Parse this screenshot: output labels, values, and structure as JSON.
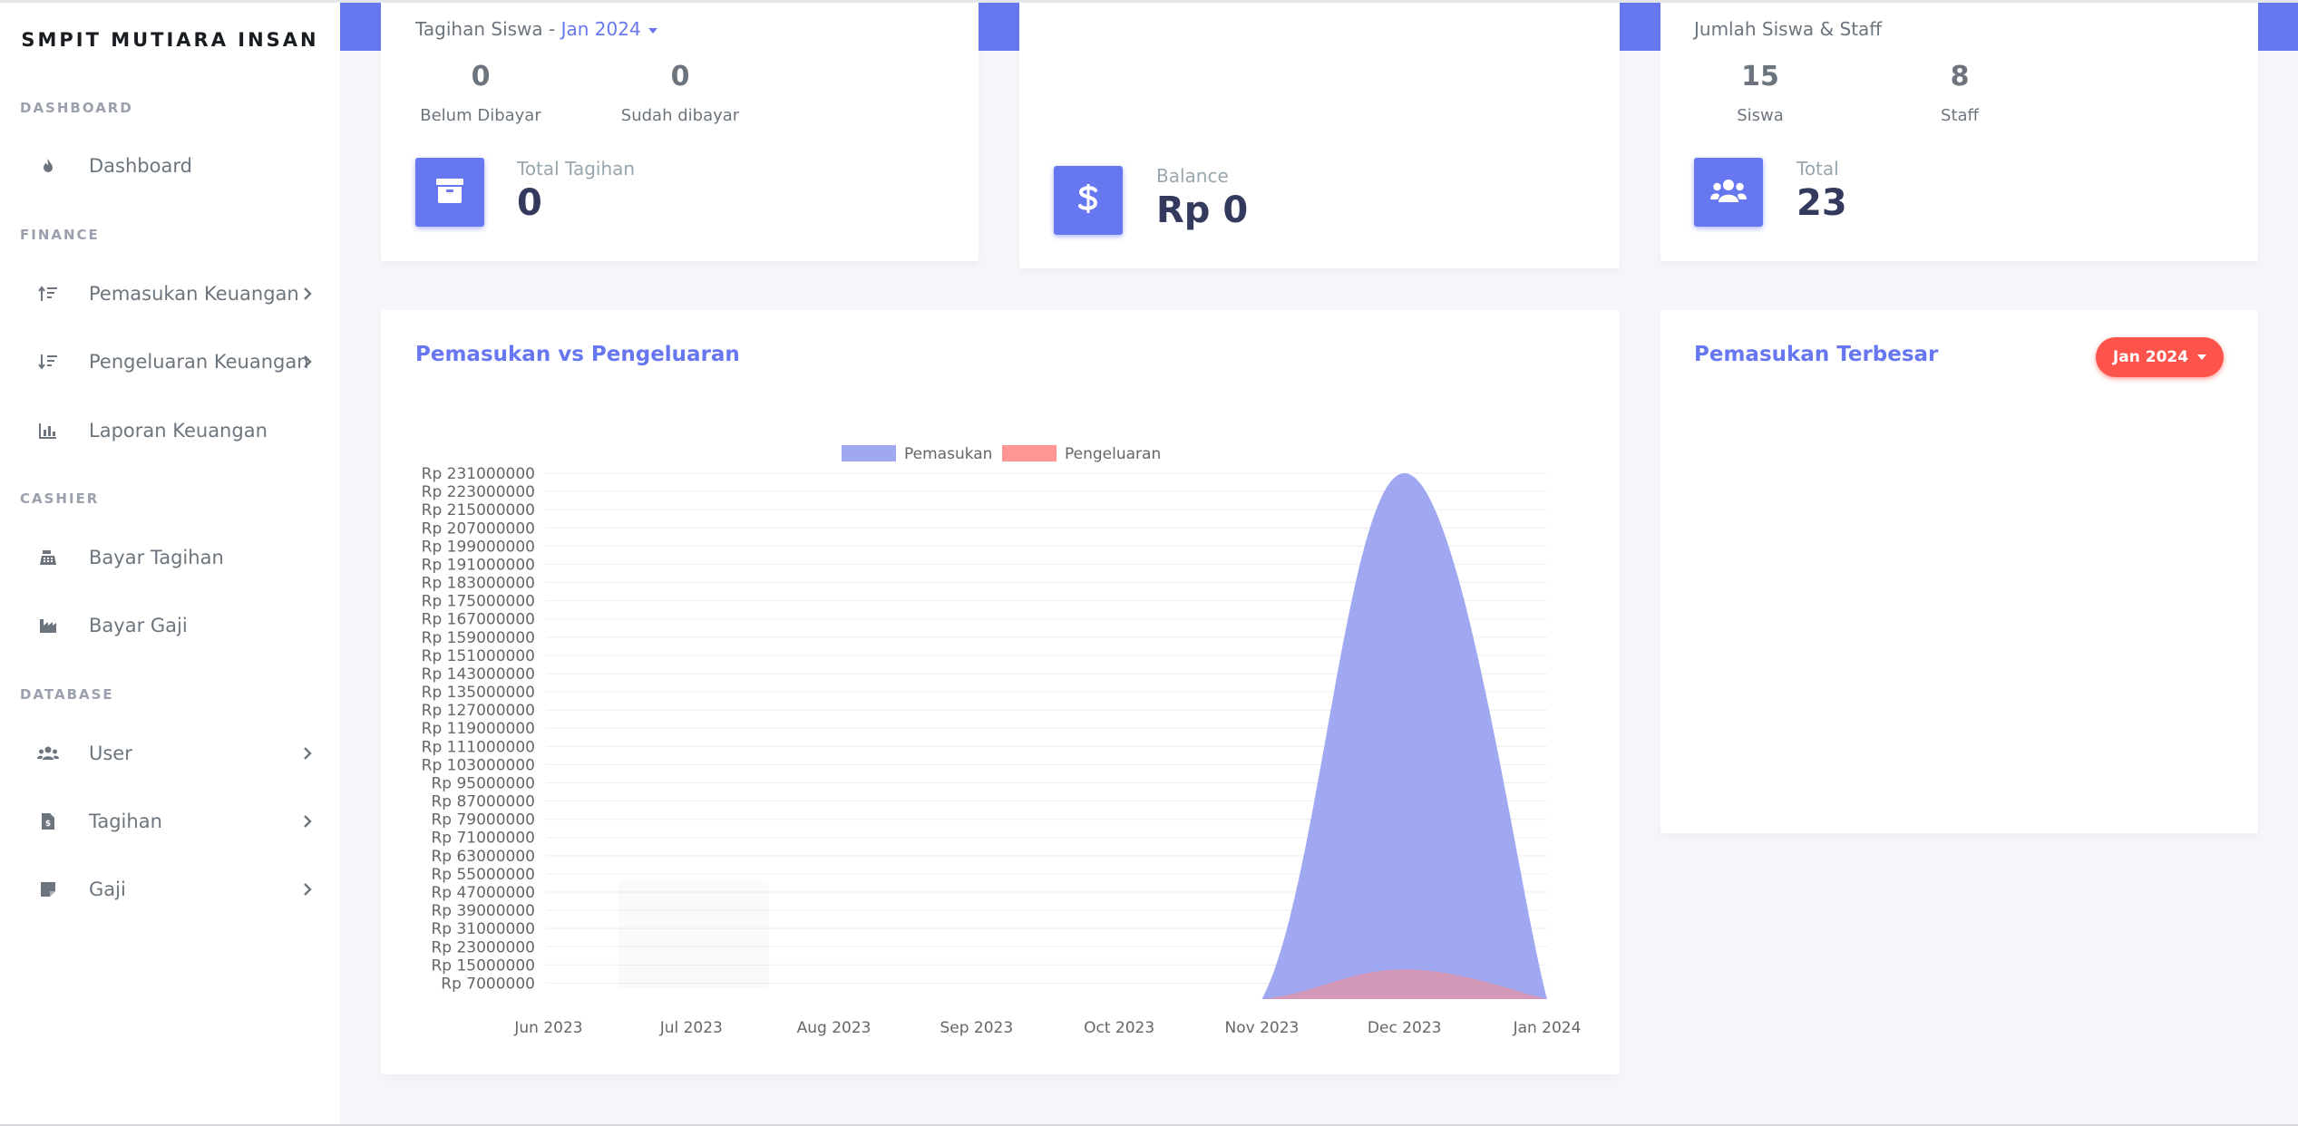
{
  "app": {
    "brand": "SMPIT MUTIARA INSAN"
  },
  "sidebar": {
    "headers": {
      "dashboard": "DASHBOARD",
      "finance": "FINANCE",
      "cashier": "CASHIER",
      "database": "DATABASE"
    },
    "items": {
      "dashboard": {
        "label": "Dashboard",
        "icon": "fire-icon"
      },
      "pemasukan": {
        "label": "Pemasukan Keuangan",
        "icon": "sort-amount-up-icon"
      },
      "pengeluaran": {
        "label": "Pengeluaran Keuangan",
        "icon": "sort-amount-down-icon"
      },
      "laporan": {
        "label": "Laporan Keuangan",
        "icon": "bar-chart-icon"
      },
      "bayar_tagihan": {
        "label": "Bayar Tagihan",
        "icon": "cash-register-icon"
      },
      "bayar_gaji": {
        "label": "Bayar Gaji",
        "icon": "industry-icon"
      },
      "user": {
        "label": "User",
        "icon": "users-icon"
      },
      "tagihan": {
        "label": "Tagihan",
        "icon": "file-invoice-icon"
      },
      "gaji": {
        "label": "Gaji",
        "icon": "sticky-note-icon"
      }
    }
  },
  "tagihan_card": {
    "title": "Tagihan Siswa",
    "separator": "-",
    "period": "Jan 2024",
    "belum_value": "0",
    "belum_label": "Belum Dibayar",
    "sudah_value": "0",
    "sudah_label": "Sudah dibayar",
    "total_label": "Total Tagihan",
    "total_value": "0",
    "icon": "archive-icon"
  },
  "balance_card": {
    "label": "Balance",
    "value": "Rp 0",
    "icon": "dollar-icon"
  },
  "siswa_card": {
    "title": "Jumlah Siswa & Staff",
    "siswa_value": "15",
    "siswa_label": "Siswa",
    "staff_value": "8",
    "staff_label": "Staff",
    "total_label": "Total",
    "total_value": "23",
    "icon": "users-icon"
  },
  "chart_section": {
    "title": "Pemasukan vs Pengeluaran"
  },
  "terbesar_section": {
    "title": "Pemasukan Terbesar",
    "period_button": "Jan 2024"
  },
  "colors": {
    "primary": "#6777ef",
    "danger": "#fc544b",
    "pemasukan_fill": "#9aa3ef",
    "pengeluaran_fill": "#ff8a8a"
  },
  "chart_data": {
    "type": "area",
    "categories": [
      "Jun 2023",
      "Jul 2023",
      "Aug 2023",
      "Sep 2023",
      "Oct 2023",
      "Nov 2023",
      "Dec 2023",
      "Jan 2024"
    ],
    "series": [
      {
        "name": "Pemasukan",
        "values": [
          0,
          0,
          0,
          0,
          0,
          0,
          231000000,
          0
        ]
      },
      {
        "name": "Pengeluaran",
        "values": [
          0,
          0,
          0,
          0,
          0,
          0,
          13000000,
          0
        ]
      }
    ],
    "ytick_labels": [
      "Rp 231000000",
      "Rp 223000000",
      "Rp 215000000",
      "Rp 207000000",
      "Rp 199000000",
      "Rp 191000000",
      "Rp 183000000",
      "Rp 175000000",
      "Rp 167000000",
      "Rp 159000000",
      "Rp 151000000",
      "Rp 143000000",
      "Rp 135000000",
      "Rp 127000000",
      "Rp 119000000",
      "Rp 111000000",
      "Rp 103000000",
      "Rp 95000000",
      "Rp 87000000",
      "Rp 79000000",
      "Rp 71000000",
      "Rp 63000000",
      "Rp 55000000",
      "Rp 47000000",
      "Rp 39000000",
      "Rp 31000000",
      "Rp 23000000",
      "Rp 15000000",
      "Rp 7000000"
    ],
    "ytick_values": [
      231000000,
      223000000,
      215000000,
      207000000,
      199000000,
      191000000,
      183000000,
      175000000,
      167000000,
      159000000,
      151000000,
      143000000,
      135000000,
      127000000,
      119000000,
      111000000,
      103000000,
      95000000,
      87000000,
      79000000,
      71000000,
      63000000,
      55000000,
      47000000,
      39000000,
      31000000,
      23000000,
      15000000,
      7000000
    ],
    "ylim": [
      0,
      231000000
    ],
    "legend": "top",
    "grid": true
  }
}
